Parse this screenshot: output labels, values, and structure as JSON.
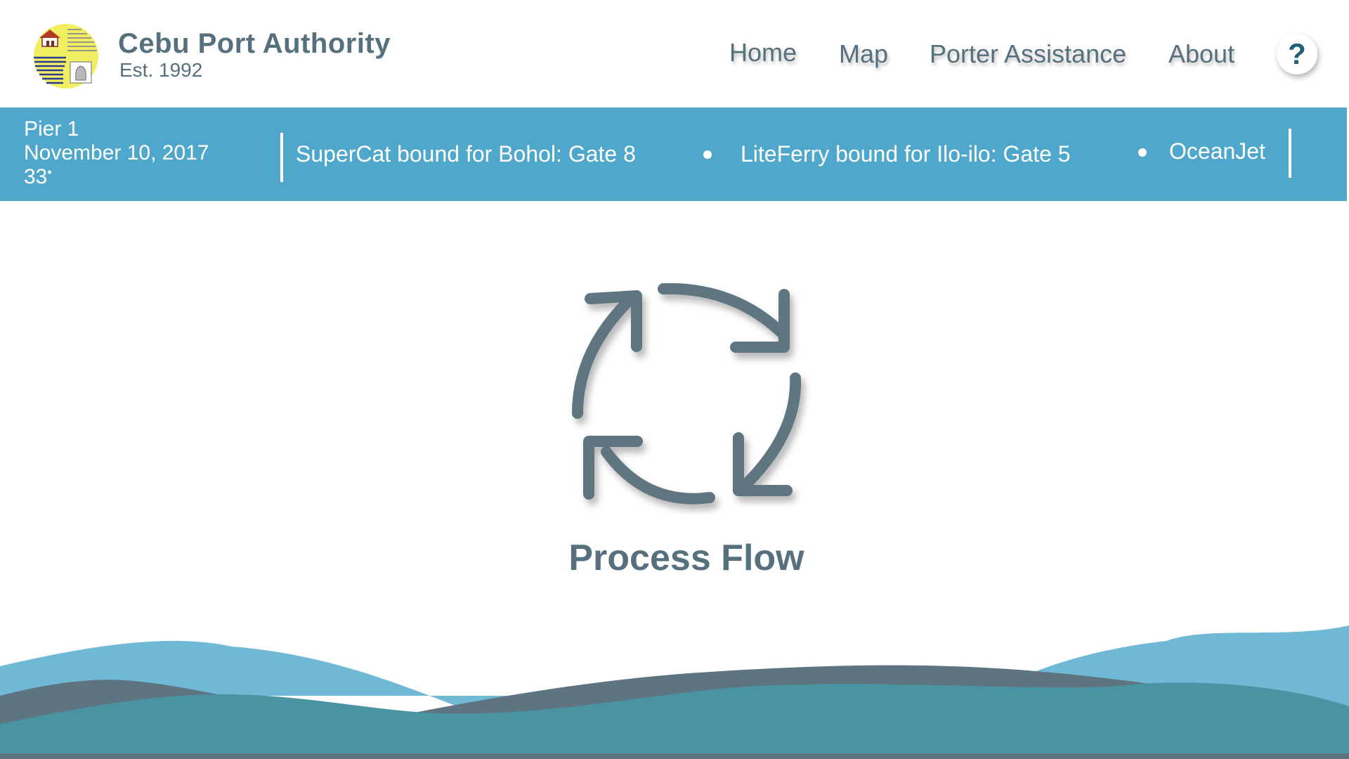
{
  "brand": {
    "title": "Cebu Port Authority",
    "subtitle": "Est. 1992"
  },
  "nav": {
    "home": "Home",
    "map": "Map",
    "porter": "Porter Assistance",
    "about": "About",
    "help": "?"
  },
  "info": {
    "pier": "Pier 1",
    "date": "November 10, 2017",
    "temperature": "33",
    "temperature_unit": "•"
  },
  "ticker": [
    "SuperCat bound for Bohol: Gate 8",
    "LiteFerry bound for Ilo-ilo: Gate 5",
    "OceanJet"
  ],
  "main": {
    "process_label": "Process Flow"
  },
  "colors": {
    "primary_text": "#56707d",
    "infobar": "#4fa8cc",
    "wave_light": "#6fb8d6",
    "wave_dark": "#5e7480",
    "wave_teal": "#4a93a3"
  },
  "icons": {
    "process": "refresh-cycle-icon",
    "help": "question-mark-icon",
    "logo": "port-authority-logo"
  }
}
